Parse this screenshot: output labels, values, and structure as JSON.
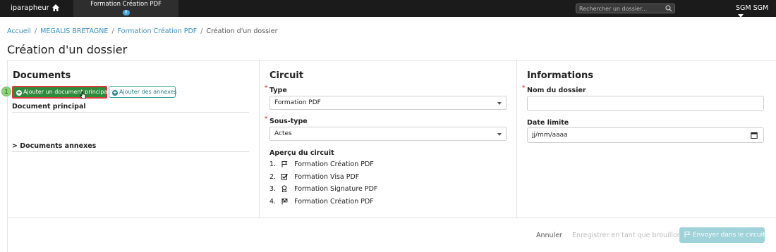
{
  "topbar": {
    "brand": "iparapheur",
    "active_tab": {
      "label": "Formation Création PDF",
      "badge": "0"
    },
    "search": {
      "placeholder": "Rechercher un dossier..."
    },
    "user": "SGM SGM"
  },
  "breadcrumb": [
    "Accueil",
    "MEGALIS BRETAGNE",
    "Formation Création PDF",
    "Création d'un dossier"
  ],
  "page_title": "Création d'un dossier",
  "documents": {
    "title": "Documents",
    "add_main_button": "Ajouter un document principal",
    "add_annex_button": "Ajouter des annexes",
    "main_document_label": "Document principal",
    "annexes_label": "> Documents annexes",
    "step_marker": "1"
  },
  "circuit": {
    "title": "Circuit",
    "type_label": "Type",
    "type_value": "Formation PDF",
    "subtype_label": "Sous-type",
    "subtype_value": "Actes",
    "preview_label": "Aperçu du circuit",
    "steps": [
      {
        "num": "1.",
        "icon": "flag-outline-icon",
        "label": "Formation Création PDF"
      },
      {
        "num": "2.",
        "icon": "checkbox-check-icon",
        "label": "Formation Visa PDF"
      },
      {
        "num": "3.",
        "icon": "seal-icon",
        "label": "Formation Signature PDF"
      },
      {
        "num": "4.",
        "icon": "checkered-flag-icon",
        "label": "Formation Création PDF"
      }
    ]
  },
  "informations": {
    "title": "Informations",
    "name_label": "Nom du dossier",
    "name_value": "",
    "deadline_label": "Date limite",
    "deadline_placeholder": "jj/mm/aaaa"
  },
  "footer": {
    "cancel": "Annuler",
    "save_draft": "Enregistrer en tant que brouillon",
    "send": "Envoyer dans le circuit"
  },
  "colors": {
    "topbar": "#1b1b1b",
    "primary_green": "#2e8b3b",
    "highlight_red": "#d63a3a",
    "teal": "#2b7f8a",
    "send_disabled": "#9fd2d9",
    "link": "#3a8fbf"
  }
}
